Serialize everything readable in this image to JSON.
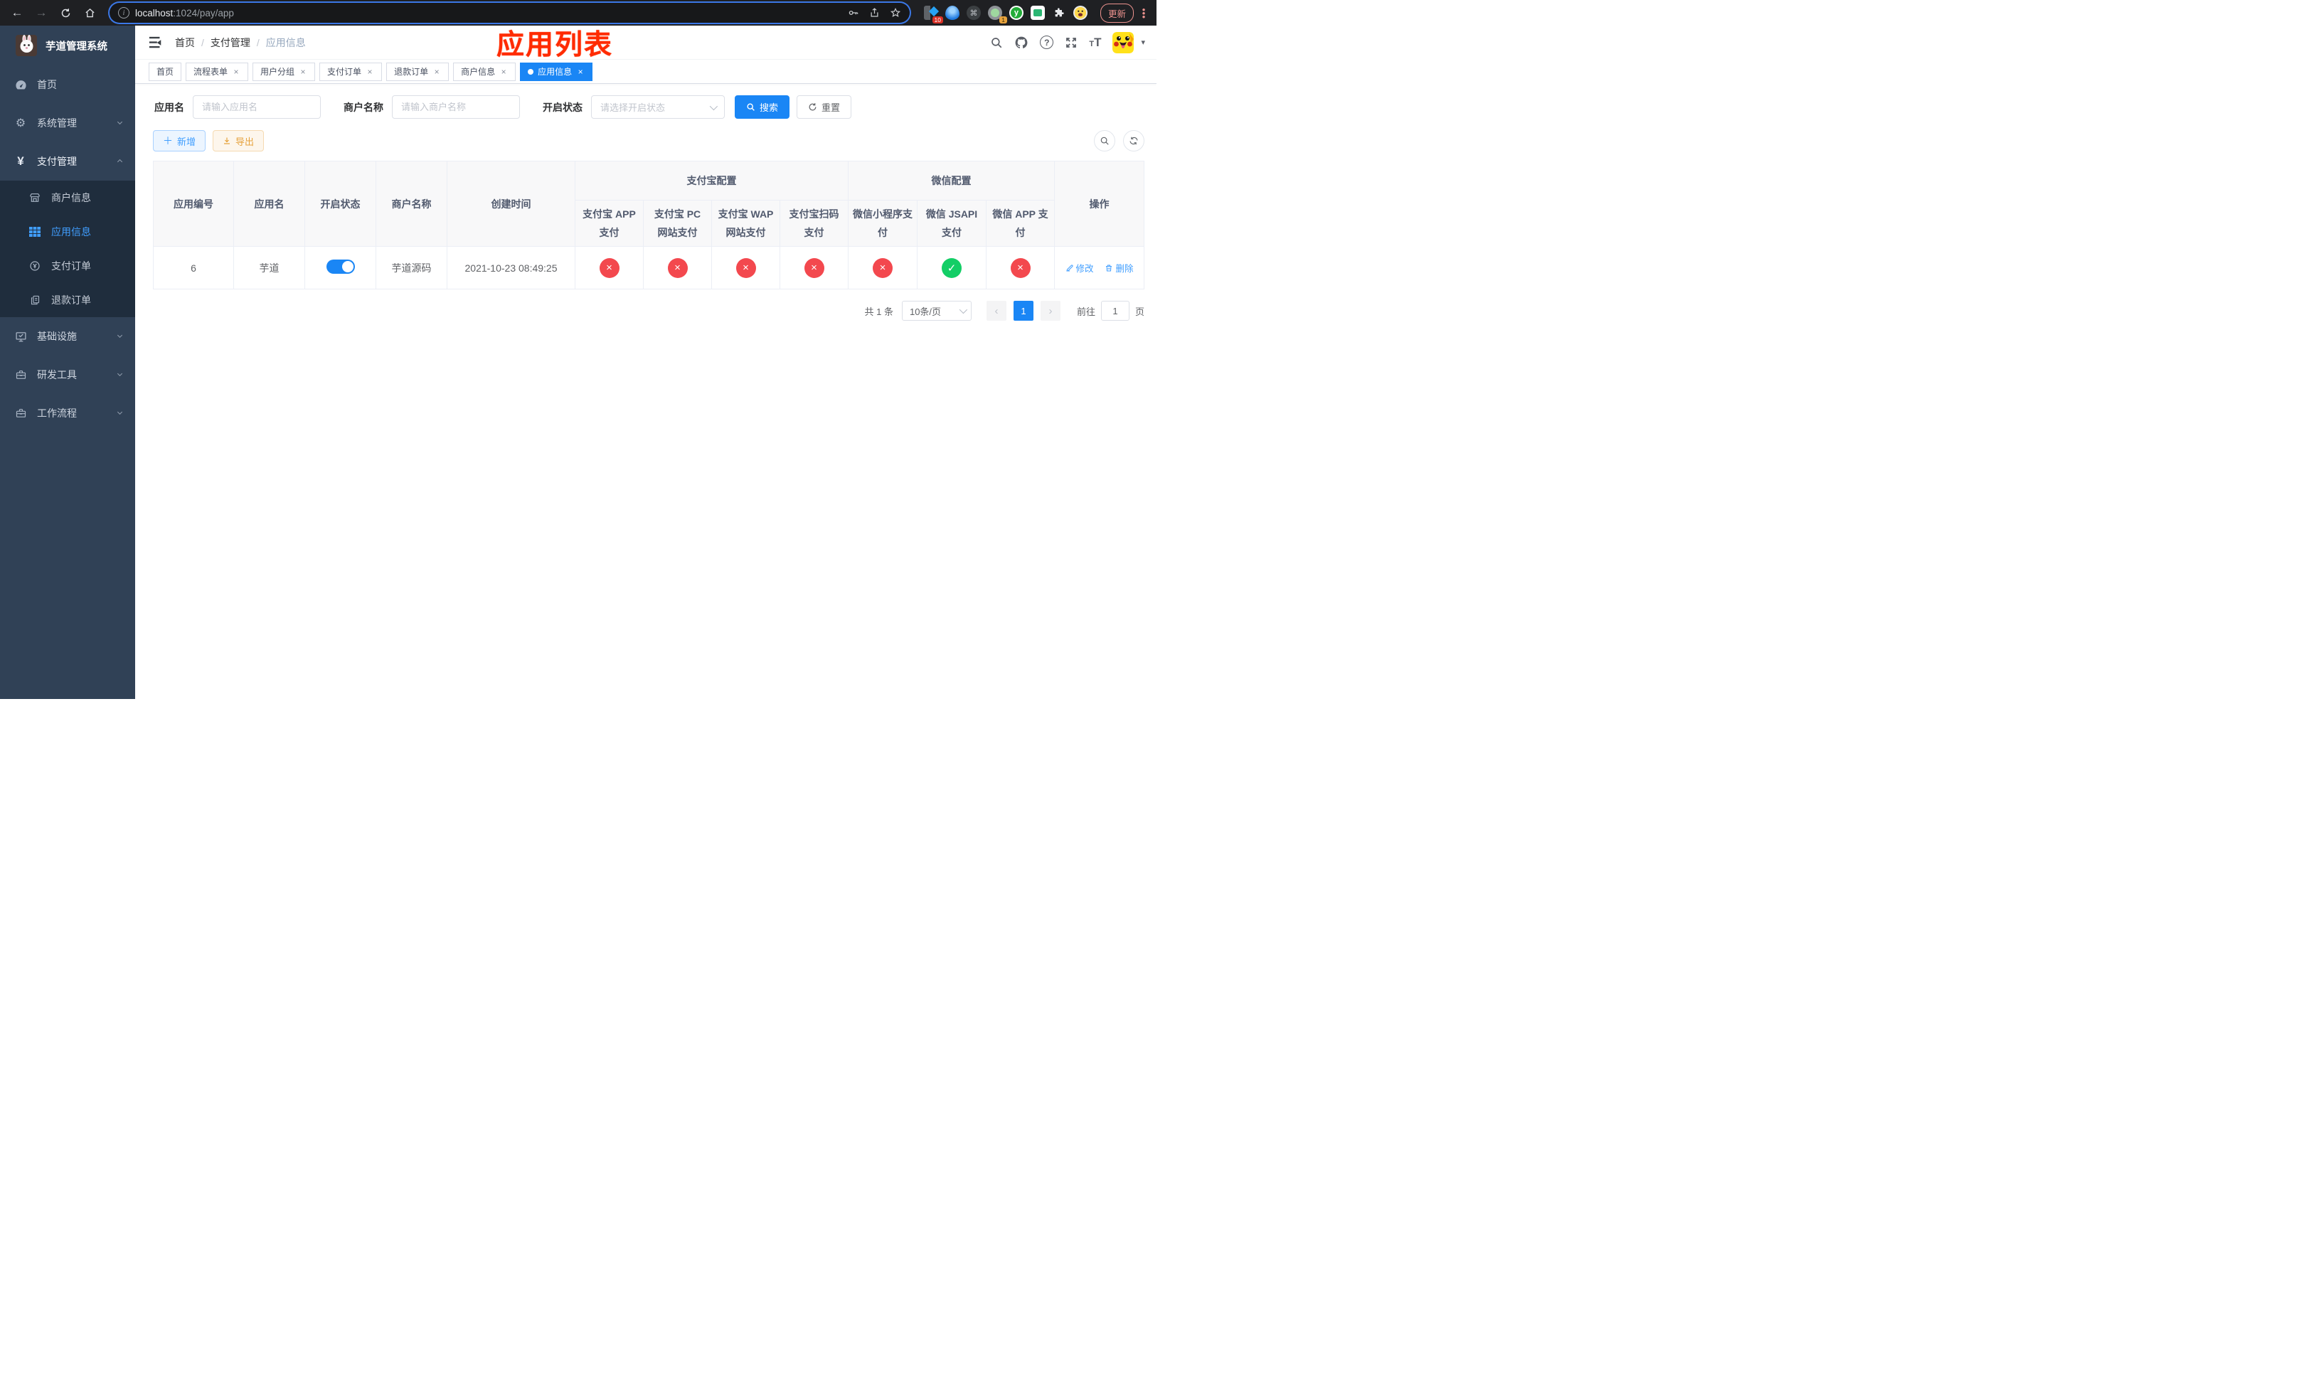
{
  "browser": {
    "url_host": "localhost",
    "url_path": ":1024/pay/app",
    "update_label": "更新",
    "ext_badge_pins": "10",
    "ext_badge_rec": "1"
  },
  "annotation": "应用列表",
  "sidebar": {
    "title": "芋道管理系统",
    "menu": [
      {
        "label": "首页"
      },
      {
        "label": "系统管理"
      },
      {
        "label": "支付管理"
      },
      {
        "label": "基础设施"
      },
      {
        "label": "研发工具"
      },
      {
        "label": "工作流程"
      }
    ],
    "submenu": [
      {
        "label": "商户信息"
      },
      {
        "label": "应用信息"
      },
      {
        "label": "支付订单"
      },
      {
        "label": "退款订单"
      }
    ]
  },
  "breadcrumb": {
    "home": "首页",
    "section": "支付管理",
    "current": "应用信息"
  },
  "tabbar": {
    "close_glyph": "×",
    "tabs": [
      {
        "label": "首页"
      },
      {
        "label": "流程表单"
      },
      {
        "label": "用户分组"
      },
      {
        "label": "支付订单"
      },
      {
        "label": "退款订单"
      },
      {
        "label": "商户信息"
      },
      {
        "label": "应用信息"
      }
    ]
  },
  "filter": {
    "app_name_label": "应用名",
    "app_name_placeholder": "请输入应用名",
    "merchant_label": "商户名称",
    "merchant_placeholder": "请输入商户名称",
    "status_label": "开启状态",
    "status_placeholder": "请选择开启状态",
    "search_label": "搜索",
    "reset_label": "重置"
  },
  "toolbar": {
    "add_label": "新增",
    "export_label": "导出"
  },
  "table": {
    "fixed_columns": [
      "应用编号",
      "应用名",
      "开启状态",
      "商户名称",
      "创建时间"
    ],
    "alipay_group": "支付宝配置",
    "alipay_columns": [
      "支付宝 APP 支付",
      "支付宝 PC 网站支付",
      "支付宝 WAP 网站支付",
      "支付宝扫码支付"
    ],
    "wechat_group": "微信配置",
    "wechat_columns": [
      "微信小程序支付",
      "微信 JSAPI 支付",
      "微信 APP 支付"
    ],
    "action_column": "操作",
    "glyphs": {
      "fail": "×",
      "success": "✓"
    },
    "row": {
      "id": "6",
      "name": "芋道",
      "enabled": true,
      "merchant": "芋道源码",
      "created_at": "2021-10-23 08:49:25",
      "configs": [
        "fail",
        "fail",
        "fail",
        "fail",
        "fail",
        "success",
        "fail"
      ],
      "edit_label": "修改",
      "delete_label": "删除"
    }
  },
  "pagination": {
    "total": "共 1 条",
    "page_size": "10条/页",
    "prev_glyph": "‹",
    "page": "1",
    "next_glyph": "›",
    "goto_label": "前往",
    "goto_value": "1",
    "page_unit": "页"
  },
  "colors": {
    "primary": "#409eff",
    "primary_strong": "#1a86f5",
    "fail_red": "#f3484e",
    "success_green": "#13ce66"
  }
}
